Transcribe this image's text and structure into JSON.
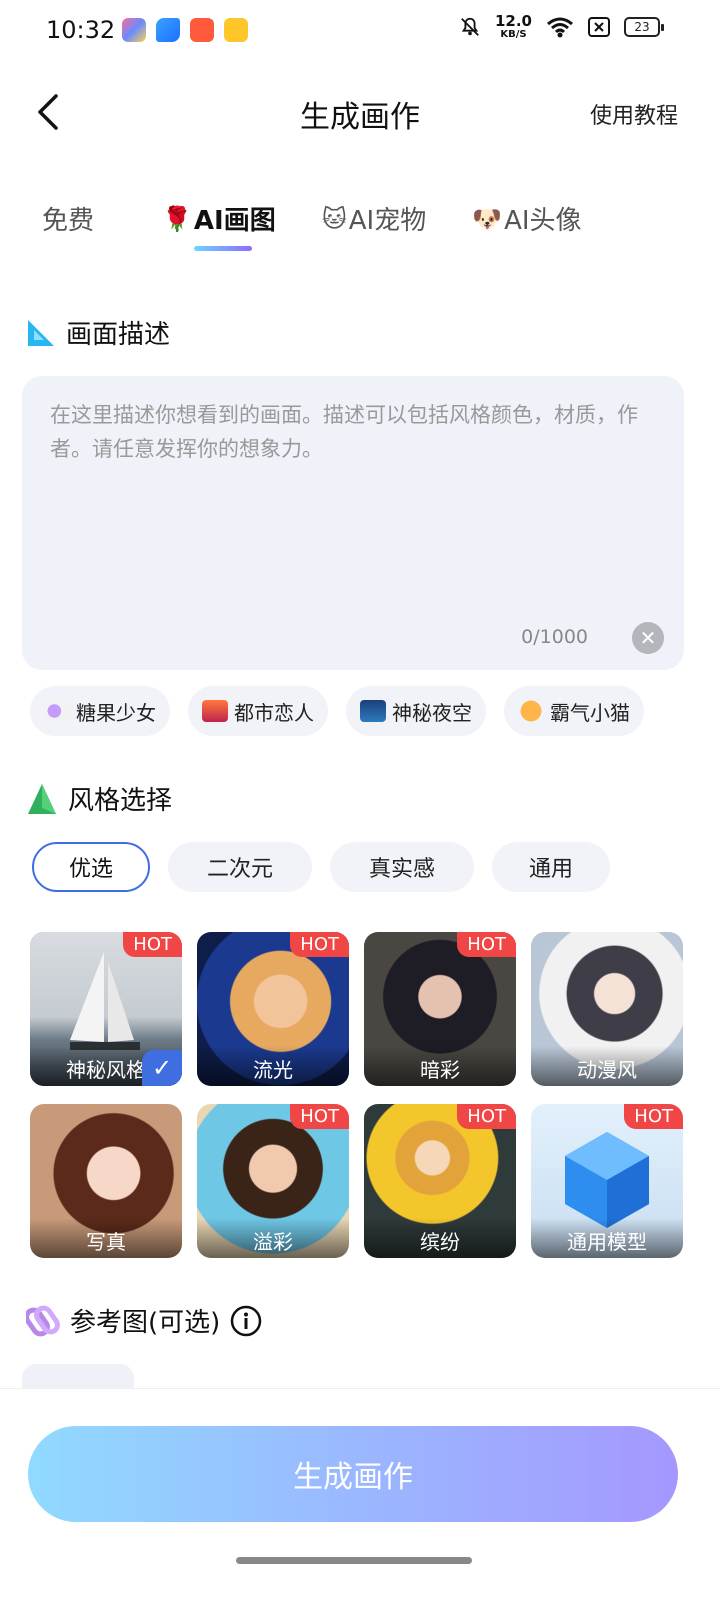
{
  "status_bar": {
    "time": "10:32",
    "net_speed_value": "12.0",
    "net_speed_unit": "KB/S",
    "battery": "23"
  },
  "header": {
    "title": "生成画作",
    "help_link": "使用教程"
  },
  "tabs": [
    {
      "emoji": "",
      "label": "免费",
      "active": false
    },
    {
      "emoji": "🌹",
      "label": "AI画图",
      "active": true
    },
    {
      "emoji": "🐱",
      "label": "AI宠物",
      "active": false
    },
    {
      "emoji": "🐶",
      "label": "AI头像",
      "active": false
    }
  ],
  "description": {
    "section_title": "画面描述",
    "placeholder": "在这里描述你想看到的画面。描述可以包括风格颜色，材质，作者。请任意发挥你的想象力。",
    "counter": "0/1000"
  },
  "suggestions": [
    {
      "label": "糖果少女",
      "icon": "candy-icon"
    },
    {
      "label": "都市恋人",
      "icon": "city-icon"
    },
    {
      "label": "神秘夜空",
      "icon": "night-sky-icon"
    },
    {
      "label": "霸气小猫",
      "icon": "cat-icon"
    }
  ],
  "style": {
    "section_title": "风格选择",
    "pills": [
      {
        "label": "优选",
        "active": true
      },
      {
        "label": "二次元",
        "active": false
      },
      {
        "label": "真实感",
        "active": false
      },
      {
        "label": "通用",
        "active": false
      }
    ],
    "hot_badge": "HOT",
    "cards": [
      {
        "label": "神秘风格",
        "hot": true,
        "selected": true
      },
      {
        "label": "流光",
        "hot": true,
        "selected": false
      },
      {
        "label": "暗彩",
        "hot": true,
        "selected": false
      },
      {
        "label": "动漫风",
        "hot": false,
        "selected": false
      },
      {
        "label": "写真",
        "hot": false,
        "selected": false
      },
      {
        "label": "溢彩",
        "hot": true,
        "selected": false
      },
      {
        "label": "缤纷",
        "hot": true,
        "selected": false
      },
      {
        "label": "通用模型",
        "hot": true,
        "selected": false
      }
    ]
  },
  "reference": {
    "section_title": "参考图(可选)"
  },
  "generate_button": "生成画作",
  "colors": {
    "accent_blue": "#3f6ee0",
    "hot_red": "#f04646",
    "button_gradient_start": "#8ad8ff",
    "button_gradient_end": "#a092ff"
  }
}
